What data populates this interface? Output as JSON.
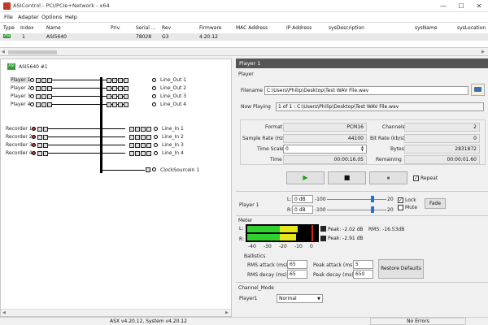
{
  "window": {
    "title": "ASIControl - PCI/PCIe+Network - x64",
    "minimize": "—",
    "maximize": "☐",
    "close": "✕"
  },
  "menu": [
    "File",
    "Adapter",
    "Options",
    "Help"
  ],
  "device_table": {
    "headers": [
      "Type",
      "Index",
      "Name",
      "Priv.",
      "Serial ...",
      "Rev",
      "Firmware",
      "MAC Address",
      "IP Address",
      "sysDescription",
      "sysName",
      "sysLocation"
    ],
    "row": {
      "type_icon": "ASI",
      "index": "1",
      "name": "ASI5640",
      "priv": "",
      "serial": "78028",
      "rev": "G3",
      "firmware": "4.20.12",
      "mac": "",
      "ip": "",
      "sysdesc": "",
      "sysname": "",
      "sysloc": ""
    }
  },
  "tree": {
    "adapter_icon": "ASI",
    "adapter_label": "ASI5640 #1",
    "players": [
      "Player 1",
      "Player 2",
      "Player 3",
      "Player 4"
    ],
    "line_outs": [
      "Line_Out 1",
      "Line_Out 2",
      "Line_Out 3",
      "Line_Out 4"
    ],
    "recorders": [
      "Recorder 1",
      "Recorder 2",
      "Recorder 3",
      "Recorder 4"
    ],
    "line_ins": [
      "Line_In 1",
      "Line_In 2",
      "Line_In 3",
      "Line_In 4"
    ],
    "clock": "ClockSourceIn 1"
  },
  "player": {
    "header": "Player 1",
    "group_label": "Player",
    "filename_label": "Filename",
    "filename": "C:\\Users\\Philip\\Desktop\\Test WAV File.wav",
    "now_playing_label": "Now Playing",
    "now_playing": "1 of 1 : C:\\Users\\Philip\\Desktop\\Test WAV File.wav",
    "format_label": "Format",
    "format": "PCM16",
    "channels_label": "Channels",
    "channels": "2",
    "sample_rate_label": "Sample Rate (Hz)",
    "sample_rate": "44100",
    "bit_rate_label": "Bit Rate (kb/s)",
    "bit_rate": "0",
    "time_scale_label": "Time Scale",
    "time_scale": "0",
    "bytes_label": "Bytes",
    "bytes": "2831872",
    "time_label": "Time",
    "time": "00:00:16.05",
    "remaining_label": "Remaining",
    "remaining": "00:00:01.60",
    "play_icon": "▶",
    "stop_icon": "■",
    "pause_icon": "⏸",
    "repeat_label": "Repeat"
  },
  "volume": {
    "label": "Player  1",
    "l_label": "L:",
    "r_label": "R:",
    "l_value": "0 dB",
    "r_value": "0 dB",
    "min_label": "-100",
    "max_label": "20",
    "lock_label": "Lock",
    "mute_label": "Mute",
    "fade_label": "Fade"
  },
  "meter": {
    "label": "Meter",
    "l_label": "L:",
    "r_label": "R:",
    "scale": [
      "-40",
      "-30",
      "-20",
      "-10",
      "0"
    ],
    "peak_l": "Peak: -2.02 dB",
    "rms_l": "RMS: -16.53dB",
    "peak_r": "Peak: -2.91 dB",
    "level_l": 0.78,
    "level_r": 0.75,
    "ballistics_label": "Ballistics",
    "rms_attack_label": "RMS attack (ms):",
    "rms_attack": "65",
    "rms_decay_label": "RMS decay (ms):",
    "rms_decay": "65",
    "peak_attack_label": "Peak attack (ms):",
    "peak_attack": "5",
    "peak_decay_label": "Peak decay (ms):",
    "peak_decay": "650",
    "restore_label": "Restore Defaults"
  },
  "channel_mode": {
    "label": "Channel_Mode",
    "player_label": "Player1",
    "value": "Normal"
  },
  "status": {
    "version": "ASX v4.20.12, System v4.20.12",
    "errors": "No Errors"
  }
}
